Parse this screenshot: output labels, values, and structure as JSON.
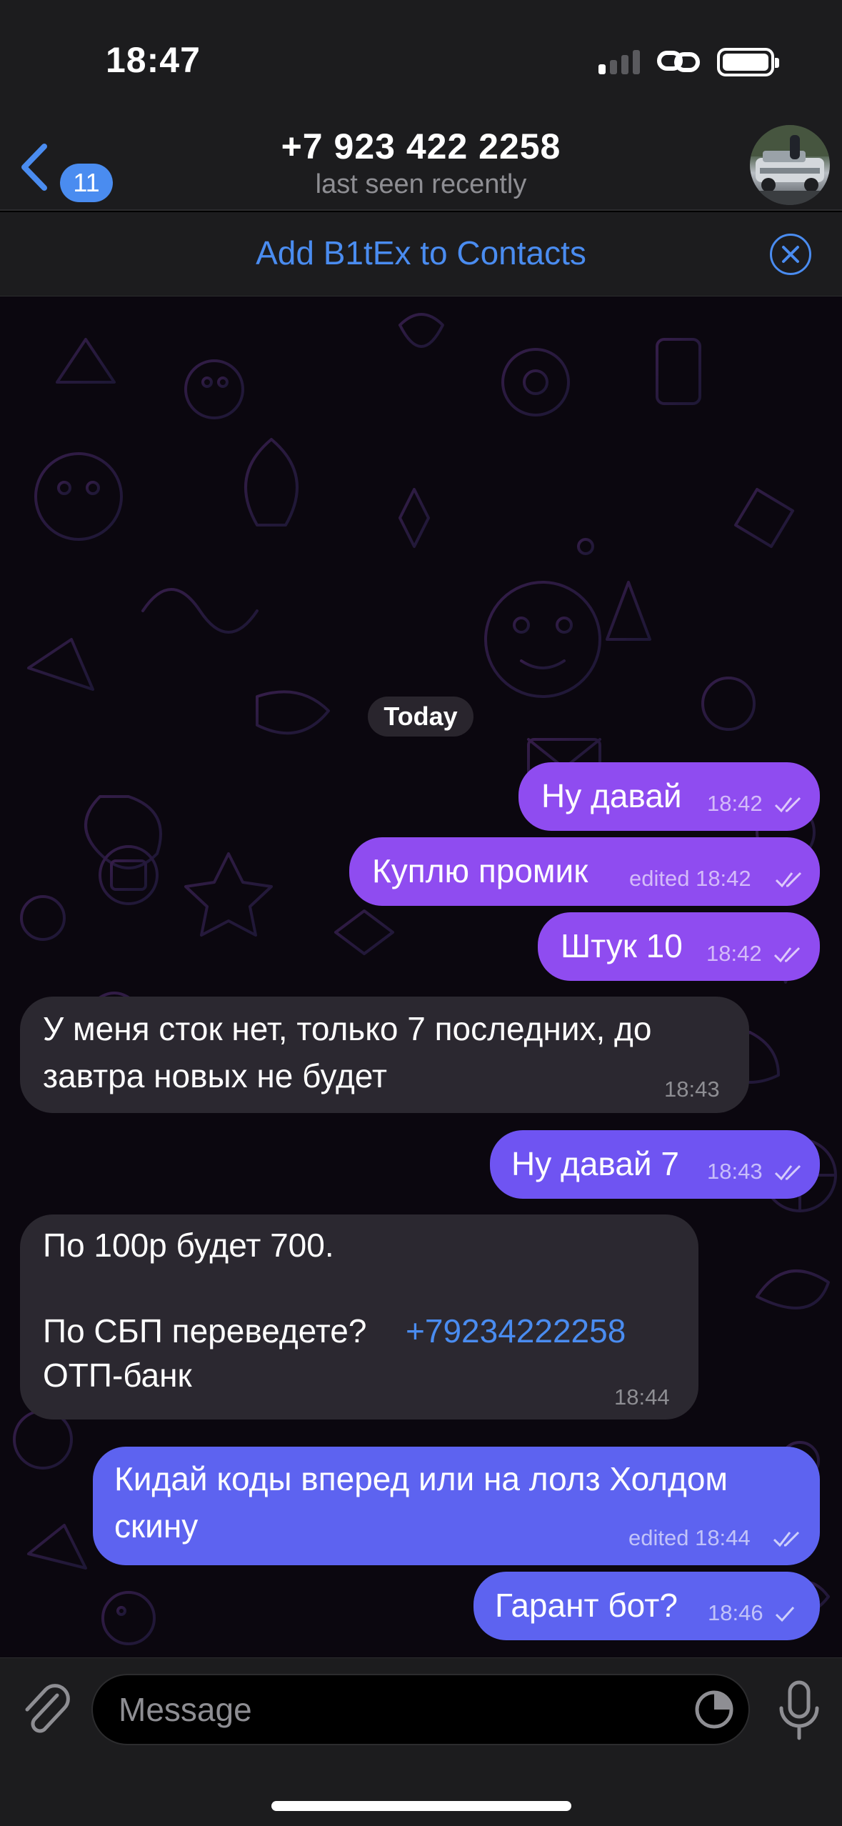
{
  "status_bar": {
    "time": "18:47"
  },
  "header": {
    "back_badge": "11",
    "contact_name": "+7 923 422 2258",
    "contact_status": "last seen recently"
  },
  "banner": {
    "add_contact_label": "Add B1tEx to Contacts"
  },
  "chat": {
    "date_label": "Today",
    "messages": [
      {
        "direction": "outgoing",
        "text": "Ну давай",
        "time": "18:42",
        "edited": false
      },
      {
        "direction": "outgoing",
        "text": "Куплю промик",
        "time": "edited 18:42",
        "edited": true
      },
      {
        "direction": "outgoing",
        "text": "Штук 10",
        "time": "18:42",
        "edited": false
      },
      {
        "direction": "incoming",
        "lines": [
          "У меня сток нет, только 7 последних, до",
          "завтра новых не будет"
        ],
        "time": "18:43"
      },
      {
        "direction": "outgoing",
        "text": "Ну давай 7",
        "time": "18:43",
        "edited": false
      },
      {
        "direction": "incoming",
        "lines": [
          "По 100р будет 700.",
          "По СБП переведете?",
          "ОТП-банк"
        ],
        "phone_link": "+79234222258",
        "time": "18:44"
      },
      {
        "direction": "outgoing",
        "lines": [
          "Кидай коды вперед или на лолз Холдом",
          "скину"
        ],
        "time": "edited 18:44",
        "edited": true
      },
      {
        "direction": "outgoing",
        "text": "Гарант бот?",
        "time": "18:46",
        "edited": false
      }
    ]
  },
  "input": {
    "placeholder": "Message"
  },
  "colors": {
    "accent": "#4a8cf0",
    "bubble_out_violet": "#8f4cf0",
    "bubble_out_indigo": "#5d63f0",
    "bubble_in": "#2b2830"
  }
}
